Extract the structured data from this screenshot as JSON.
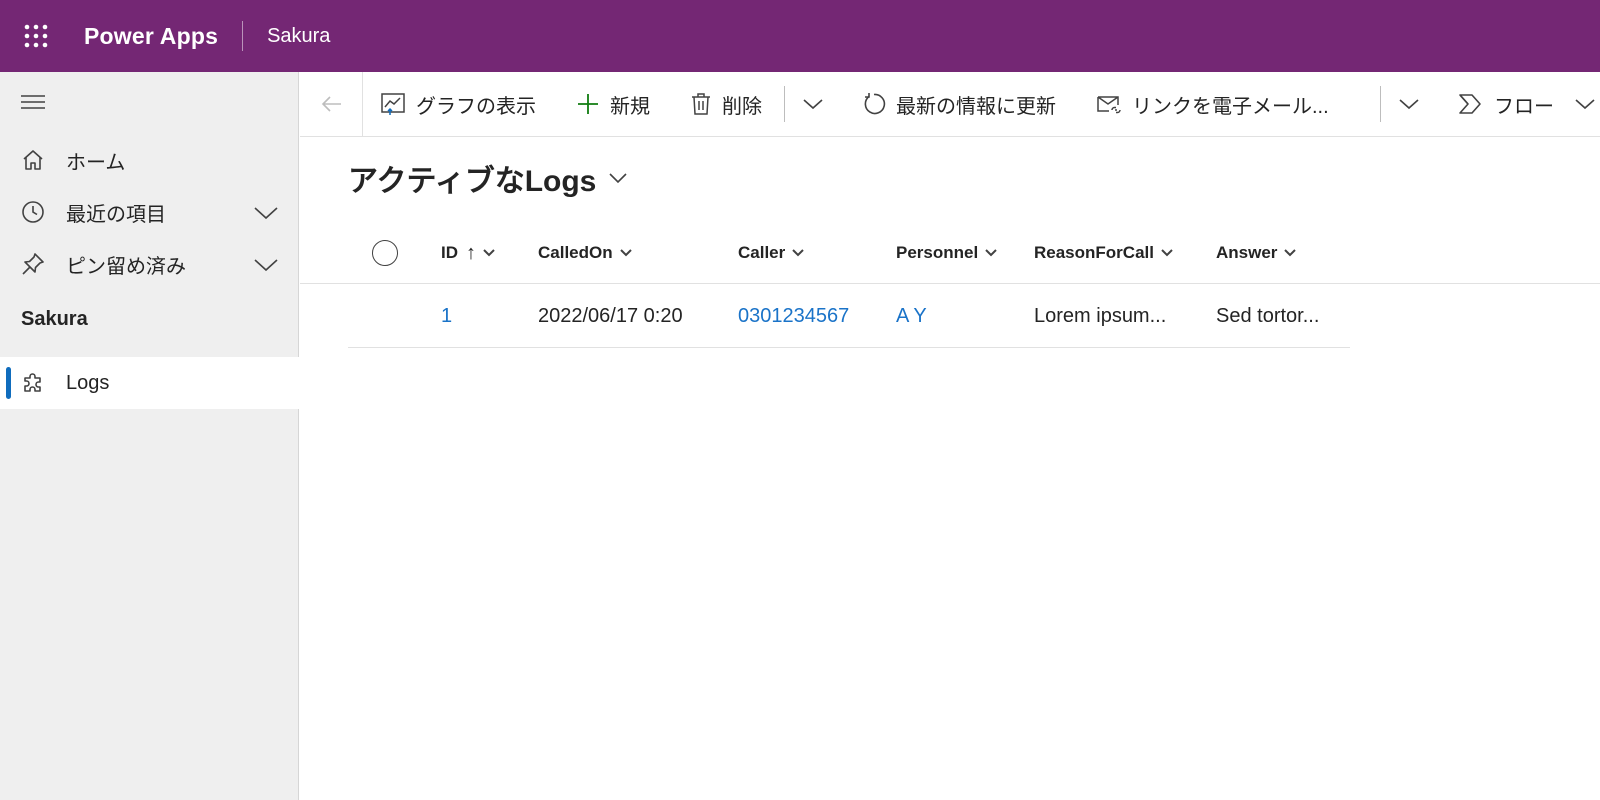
{
  "header": {
    "app_title": "Power Apps",
    "environment": "Sakura",
    "brand_color": "#742774"
  },
  "sidebar": {
    "items": [
      {
        "label": "ホーム",
        "icon": "home-icon"
      },
      {
        "label": "最近の項目",
        "icon": "clock-icon"
      },
      {
        "label": "ピン留め済み",
        "icon": "pin-icon"
      }
    ],
    "section_title": "Sakura",
    "entities": [
      {
        "label": "Logs",
        "icon": "puzzle-icon",
        "selected": true
      }
    ]
  },
  "commandbar": {
    "show_chart": "グラフの表示",
    "new": "新規",
    "delete": "削除",
    "refresh": "最新の情報に更新",
    "email_link": "リンクを電子メール...",
    "flow": "フロー"
  },
  "view": {
    "title": "アクティブなLogs"
  },
  "grid": {
    "columns": [
      "ID",
      "CalledOn",
      "Caller",
      "Personnel",
      "ReasonForCall",
      "Answer"
    ],
    "sort_indicator": "↑",
    "rows": [
      {
        "id": "1",
        "called_on": "2022/06/17 0:20",
        "caller": "0301234567",
        "personnel": "A Y",
        "reason": "Lorem ipsum...",
        "answer": "Sed tortor..."
      }
    ]
  },
  "colors": {
    "link": "#1a73c8",
    "accent": "#0f6cbd",
    "new_icon": "#107c10"
  }
}
